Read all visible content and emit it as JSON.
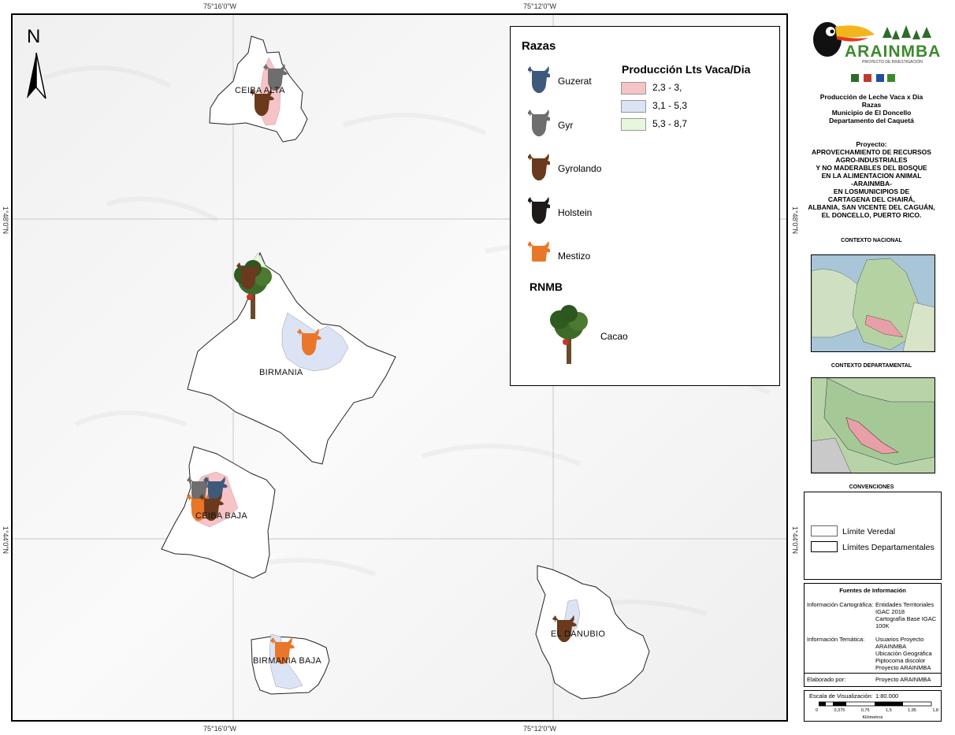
{
  "coords": {
    "top_left": "75°16'0\"W",
    "top_right": "75°12'0\"W",
    "bottom_left": "75°16'0\"W",
    "bottom_right": "75°12'0\"W",
    "left_upper": "1°48'0\"N",
    "left_lower": "1°44'0\"N",
    "right_upper": "1°48'0\"N",
    "right_lower": "1°44'0\"N"
  },
  "north": "N",
  "map_labels": {
    "ceiba_alta": "CEIBA ALTA",
    "birmania": "BIRMANIA",
    "ceiba_baja": "CEIBA  BAJA",
    "birmania_baja": "BIRMANIA BAJA",
    "el_danubio": "EL DANUBIO"
  },
  "legend": {
    "razas_title": "Razas",
    "produccion_title": "Producción Lts Vaca/Dia",
    "breeds": [
      {
        "label": "Guzerat",
        "color": "#3d5a7a"
      },
      {
        "label": "Gyr",
        "color": "#6e6e6e"
      },
      {
        "label": "Gyrolando",
        "color": "#6b3a1e"
      },
      {
        "label": "Holstein",
        "color": "#1e1a1a"
      },
      {
        "label": "Mestizo",
        "color": "#e8772a"
      }
    ],
    "ranges": [
      {
        "label": "2,3 - 3,",
        "color": "#f6c3c6"
      },
      {
        "label": "3,1 - 5,3",
        "color": "#dbe3f4"
      },
      {
        "label": "5,3 - 8,7",
        "color": "#e8f6dd"
      }
    ],
    "rnmb_title": "RNMB",
    "cacao": "Cacao"
  },
  "brand": {
    "logo_text": "ARAINMBA",
    "logo_sub": "PROYECTO DE INVESTIGACIÓN"
  },
  "title_block": {
    "line1": "Producción de Leche Vaca x Dia",
    "line2": "Razas",
    "line3": "Municipio de El Doncello",
    "line4": "Departamento del Caquetá"
  },
  "project": {
    "label": "Proyecto:",
    "lines": [
      "APROVECHAMIENTO DE RECURSOS",
      "AGRO-INDUSTRIALES",
      "Y NO MADERABLES DEL BOSQUE",
      "EN LA ALIMENTACION ANIMAL",
      "-ARAINMBA-",
      "EN LOSMUNICIPIOS DE",
      "CARTAGENA DEL CHAIRÁ,",
      "ALBANIA, SAN VICENTE DEL CAGUÁN,",
      "EL DONCELLO, PUERTO RICO."
    ]
  },
  "contexto_nacional": "CONTEXTO NACIONAL",
  "contexto_departamental": "CONTEXTO DEPARTAMENTAL",
  "convenciones": {
    "title": "CONVENCIONES",
    "limite_veredal": "Límite Veredal",
    "limites_departamentales": "Límites Departamentales"
  },
  "fuentes": {
    "title": "Fuentes de Información",
    "cartografica_label": "Información Cartográfica:",
    "cartografica_values": [
      "Entidades Territoriales",
      "IGAC 2018",
      "Cartografía Base IGAC",
      "100K"
    ],
    "tematica_label": "Información Temática:",
    "tematica_values": [
      "Usuarios Proyecto",
      "ARAINMBA",
      "Ubicación Geográfica",
      "Piptocoma discolor",
      "Proyecto ARAINMBA"
    ],
    "elaborado_label": "Elaborado por:",
    "elaborado_value": "Proyecto ARAINMBA"
  },
  "scale": {
    "label": "Escala de Visualización:",
    "value": "1:80.000",
    "ticks": [
      "0",
      "0,375",
      "0,75",
      "1,5",
      "1,95",
      "1,8"
    ],
    "unit": "Kilómetros"
  }
}
